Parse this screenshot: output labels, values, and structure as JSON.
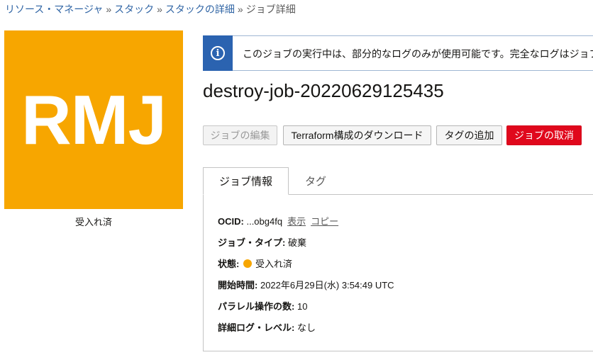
{
  "breadcrumb": {
    "items": [
      "リソース・マネージャ",
      "スタック",
      "スタックの詳細"
    ],
    "separator": "»",
    "current": "ジョブ詳細"
  },
  "logo": {
    "text": "RMJ",
    "color": "#f7a600"
  },
  "logo_status": "受入れ済",
  "banner": {
    "text": "このジョブの実行中は、部分的なログのみが使用可能です。完全なログはジョブ"
  },
  "job": {
    "title": "destroy-job-20220629125435"
  },
  "buttons": {
    "edit": "ジョブの編集",
    "download": "Terraform構成のダウンロード",
    "add_tag": "タグの追加",
    "cancel": "ジョブの取消"
  },
  "tabs": {
    "info": "ジョブ情報",
    "tags": "タグ"
  },
  "details": {
    "ocid_label": "OCID:",
    "ocid_value": "...obg4fq",
    "ocid_show": "表示",
    "ocid_copy": "コピー",
    "type_label": "ジョブ・タイプ:",
    "type_value": "破棄",
    "state_label": "状態:",
    "state_value": "受入れ済",
    "start_label": "開始時間:",
    "start_value": "2022年6月29日(水) 3:54:49 UTC",
    "parallel_label": "パラレル操作の数:",
    "parallel_value": "10",
    "log_label": "詳細ログ・レベル:",
    "log_value": "なし"
  }
}
